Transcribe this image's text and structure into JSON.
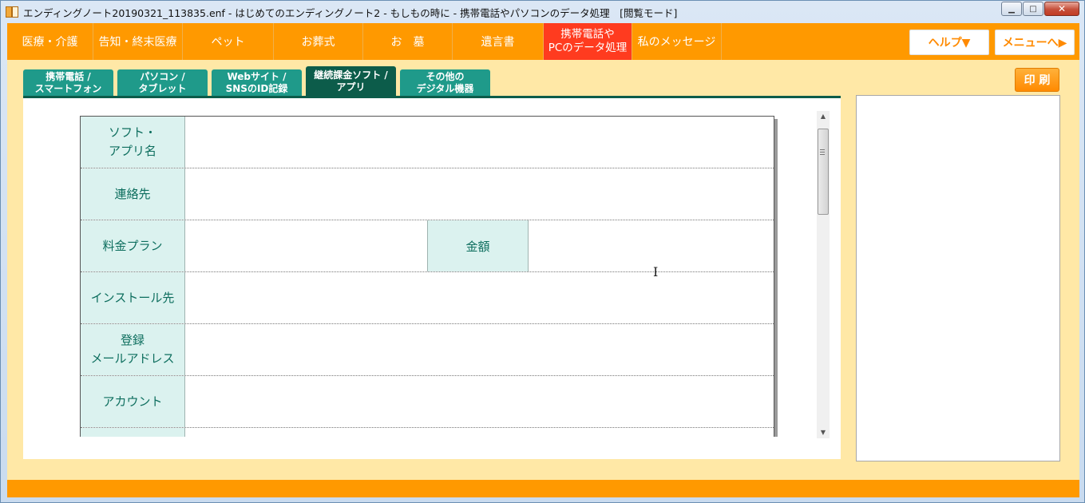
{
  "window": {
    "title": "エンディングノート20190321_113835.enf - はじめてのエンディングノート2 - もしもの時に - 携帯電話やパソコンのデータ処理　[閲覧モード]",
    "minimize": "▁",
    "maximize": "□",
    "close": "✕"
  },
  "nav": {
    "items": [
      {
        "label": "医療・介護"
      },
      {
        "label": "告知・終末医療"
      },
      {
        "label": "ペット"
      },
      {
        "label": "お葬式"
      },
      {
        "label": "お　墓"
      },
      {
        "label": "遺言書"
      },
      {
        "label_line1": "携帯電話や",
        "label_line2": "PCのデータ処理"
      },
      {
        "label": "私のメッセージ"
      }
    ],
    "help": "ヘルプ▼",
    "menu": "メニューへ▶"
  },
  "tabs": [
    {
      "line1": "携帯電話 /",
      "line2": "スマートフォン"
    },
    {
      "line1": "パソコン /",
      "line2": "タブレット"
    },
    {
      "line1": "Webサイト /",
      "line2": "SNSのID記録"
    },
    {
      "line1": "継続課金ソフト /",
      "line2": "アプリ"
    },
    {
      "line1": "その他の",
      "line2": "デジタル機器"
    }
  ],
  "print_label": "印 刷",
  "form": {
    "rows": [
      {
        "line1": "ソフト・",
        "line2": "アプリ名"
      },
      {
        "label": "連絡先"
      },
      {
        "label": "料金プラン",
        "sub_label": "金額"
      },
      {
        "label": "インストール先"
      },
      {
        "line1": "登録",
        "line2": "メールアドレス"
      },
      {
        "label": "アカウント"
      }
    ]
  },
  "scrollbar": {
    "up": "▲",
    "down": "▼"
  },
  "cursor": "I"
}
